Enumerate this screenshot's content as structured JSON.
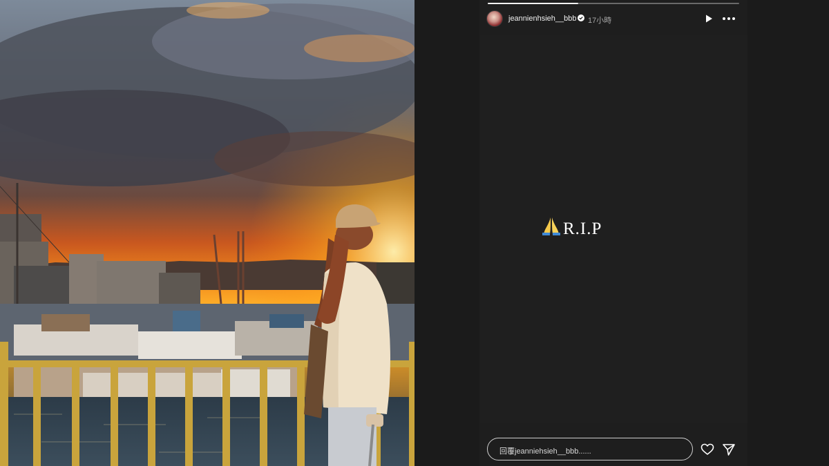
{
  "story": {
    "progress_fraction": 0.36,
    "username": "jeannienhsieh__bbb",
    "verified": true,
    "time_ago": "17小時",
    "text": "R.I.P",
    "emoji_icon": "praying-hands-icon"
  },
  "reply": {
    "placeholder": "回覆jeanniehsieh__bbb......"
  },
  "icons": {
    "play": "play-icon",
    "more": "more-options-icon",
    "like": "heart-icon",
    "share": "send-icon"
  },
  "colors": {
    "sunset_orange": "#f39a1e",
    "railing_yellow": "#c8a53a",
    "story_background": "#1f1f1f"
  }
}
